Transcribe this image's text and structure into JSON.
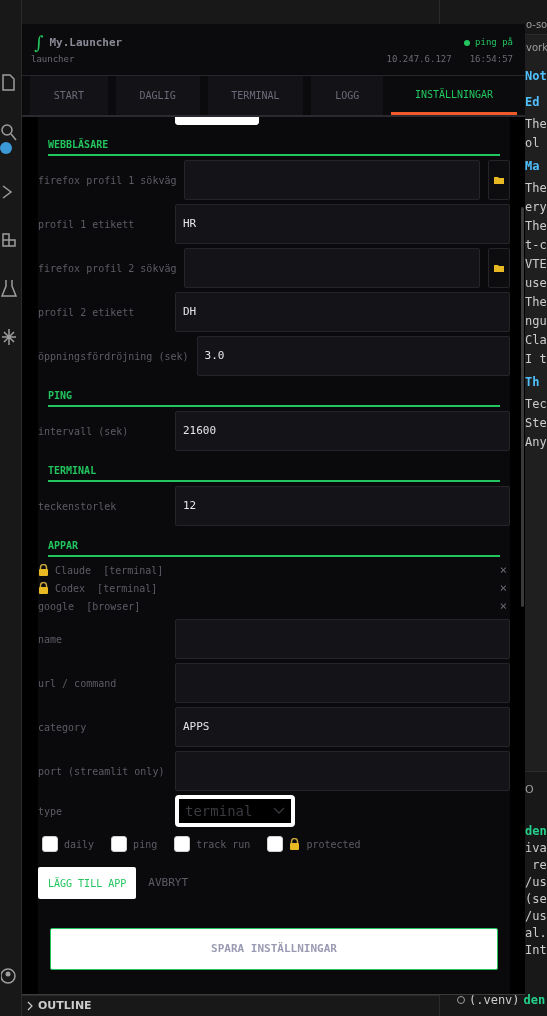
{
  "editor": {
    "tab": "o-so",
    "breadcrumb": "vork",
    "lines": [
      {
        "kind": "heading",
        "text": "Not"
      },
      {
        "kind": "heading",
        "text": "Ed"
      },
      {
        "kind": "text",
        "text": "The"
      },
      {
        "kind": "text",
        "text": "ol"
      },
      {
        "kind": "heading",
        "text": "Ma"
      },
      {
        "kind": "text",
        "text": "The"
      },
      {
        "kind": "text",
        "text": "ery"
      },
      {
        "kind": "text",
        "text": "The"
      },
      {
        "kind": "text",
        "text": "t-c"
      },
      {
        "kind": "text",
        "text": "VTE"
      },
      {
        "kind": "text",
        "text": "use"
      },
      {
        "kind": "text",
        "text": "The"
      },
      {
        "kind": "text",
        "text": "ngu"
      },
      {
        "kind": "text",
        "text": "Cla"
      },
      {
        "kind": "text",
        "text": "I t"
      },
      {
        "kind": "heading",
        "text": "Th"
      },
      {
        "kind": "text",
        "text": "Tec"
      },
      {
        "kind": "text",
        "text": "Ste"
      },
      {
        "kind": "text",
        "text": "Any"
      }
    ]
  },
  "panel": {
    "tab": "O",
    "lines": [
      {
        "kind": "accent",
        "text": "den"
      },
      {
        "kind": "text",
        "text": "iva"
      },
      {
        "kind": "text",
        "text": " re"
      },
      {
        "kind": "text",
        "text": "/us"
      },
      {
        "kind": "text",
        "text": "(se"
      },
      {
        "kind": "text",
        "text": "/us"
      },
      {
        "kind": "text",
        "text": "al."
      },
      {
        "kind": "text",
        "text": "Int"
      }
    ],
    "prompt_env": "(.venv)",
    "prompt_user": "den"
  },
  "outline": "OUTLINE",
  "launcher": {
    "logo": "∫",
    "title": "My.Launcher",
    "subtitle": "launcher",
    "status": {
      "text": "ping på",
      "on": true
    },
    "ip": "10.247.6.127",
    "time": "16:54:57",
    "tabs": [
      {
        "label": "START",
        "selected": false
      },
      {
        "label": "DAGLIG",
        "selected": false
      },
      {
        "label": "TERMINAL",
        "selected": false
      },
      {
        "label": "LOGG",
        "selected": false
      },
      {
        "label": "INSTÄLLNINGAR",
        "selected": true
      }
    ],
    "sections": [
      {
        "title": "WEBBLÄSARE",
        "fields": [
          {
            "label": "firefox profil 1 sökväg",
            "browse": true
          },
          {
            "label": "profil 1 etikett",
            "value": "HR"
          },
          {
            "label": "firefox profil 2 sökväg",
            "browse": true
          },
          {
            "label": "profil 2 etikett",
            "value": "DH"
          },
          {
            "label": "öppningsfördröjning (sek)",
            "value": "3.0"
          }
        ]
      },
      {
        "title": "PING",
        "fields": [
          {
            "label": "intervall (sek)",
            "value": "21600"
          }
        ]
      },
      {
        "title": "TERMINAL",
        "fields": [
          {
            "label": "teckenstorlek",
            "value": "12"
          }
        ]
      },
      {
        "title": "APPAR",
        "apps": [
          {
            "name": "Claude",
            "type": "[terminal]",
            "locked": true,
            "remove": "×"
          },
          {
            "name": "Codex",
            "type": "[terminal]",
            "locked": true,
            "remove": "×"
          },
          {
            "name": "google",
            "type": "[browser]",
            "locked": false,
            "remove": "×"
          }
        ],
        "fields": [
          {
            "label": "name"
          },
          {
            "label": "url / command"
          },
          {
            "label": "category",
            "value": "APPS"
          },
          {
            "label": "port (streamlit only)"
          }
        ],
        "type_select": {
          "label": "type",
          "value": "terminal"
        },
        "checkboxes": [
          {
            "label": "daily",
            "checked": false,
            "locked": false
          },
          {
            "label": "ping",
            "checked": false,
            "locked": false
          },
          {
            "label": "track run",
            "checked": false,
            "locked": false
          },
          {
            "label": "protected",
            "checked": false,
            "locked": true
          }
        ],
        "add_button": "LÄGG TILL APP",
        "cancel_button": "AVBRYT"
      }
    ],
    "save_button": "SPARA INSTÄLLNINGAR"
  }
}
